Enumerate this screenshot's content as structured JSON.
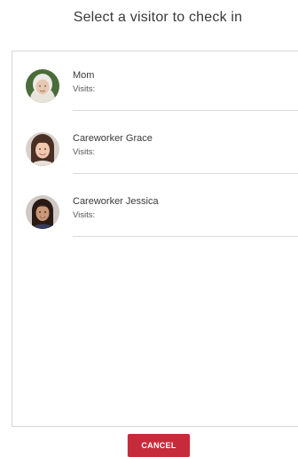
{
  "dialog": {
    "title": "Select a visitor to check in"
  },
  "visitors": [
    {
      "name": "Mom",
      "visits_label": "Visits:"
    },
    {
      "name": "Careworker Grace",
      "visits_label": "Visits:"
    },
    {
      "name": "Careworker Jessica",
      "visits_label": "Visits:"
    }
  ],
  "actions": {
    "cancel_label": "CANCEL"
  },
  "colors": {
    "cancel_button": "#c62b3c",
    "divider": "#d9d9d9"
  }
}
